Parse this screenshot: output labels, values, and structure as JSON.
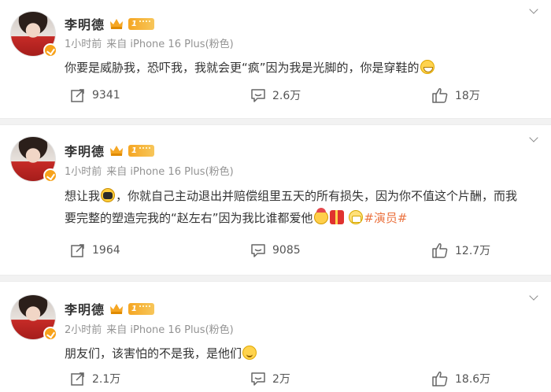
{
  "posts": [
    {
      "author": "李明德",
      "level": "1",
      "time": "1小时前",
      "source": "来自 iPhone 16 Plus(粉色)",
      "text_parts": [
        "你要是威胁我，恐吓我，我就会更“疯”因为我是光脚的，你是穿鞋的"
      ],
      "reposts": "9341",
      "comments": "2.6万",
      "likes": "18万"
    },
    {
      "author": "李明德",
      "level": "1",
      "time": "1小时前",
      "source": "来自 iPhone 16 Plus(粉色)",
      "text_parts": [
        "想让我",
        "，你就自己主动退出并赔偿组里五天的所有损失，因为你不值这个片酬，而我要完整的塑造完我的“赵左右”因为我比谁都爱他"
      ],
      "topic": "#演员#",
      "reposts": "1964",
      "comments": "9085",
      "likes": "12.7万"
    },
    {
      "author": "李明德",
      "level": "1",
      "time": "2小时前",
      "source": "来自 iPhone 16 Plus(粉色)",
      "text_parts": [
        "朋友们，该害怕的不是我，是他们"
      ],
      "reposts": "2.1万",
      "comments": "2万",
      "likes": "18.6万"
    }
  ],
  "colors": {
    "accent": "#eb7340",
    "text": "#333333",
    "meta": "#939393",
    "separator": "#f2f2f2",
    "badge": "#f7a21b"
  },
  "icons": {
    "repost": "share-icon",
    "comment": "comment-icon",
    "like": "thumbs-up-icon",
    "more": "chevron-down-icon"
  }
}
